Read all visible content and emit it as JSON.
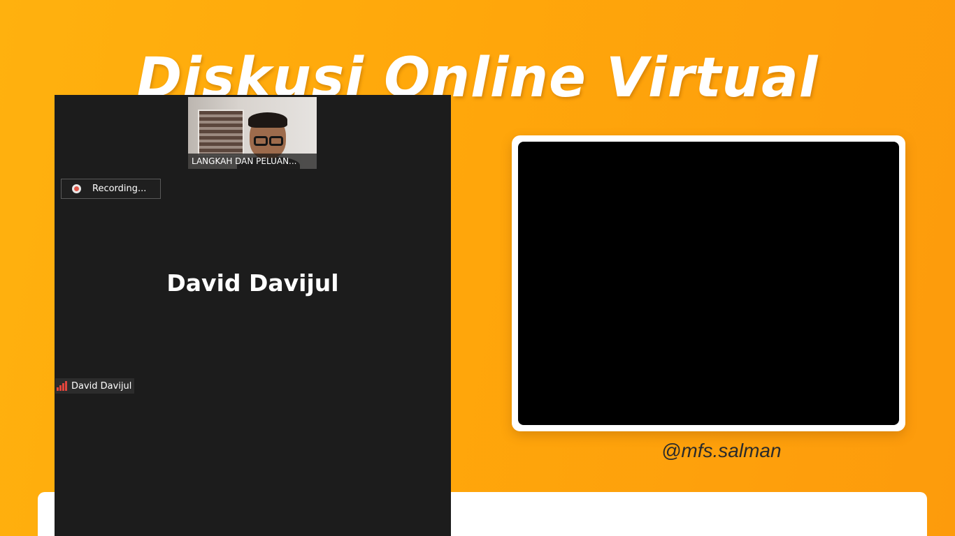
{
  "banner": {
    "title": "Diskusi Online Virtual",
    "handle": "@mfs.salman"
  },
  "meeting": {
    "thumbnail_label": "LANGKAH DAN PELUAN...",
    "recording_label": "Recording...",
    "speaker_name": "David Davijul",
    "name_tag": "David Davijul"
  },
  "colors": {
    "background": "#ffa70b",
    "meeting_bg": "#1c1c1c",
    "recording_accent": "#e0574a",
    "signal": "#e2453c"
  },
  "icons": {
    "recording": "record-icon",
    "signal": "signal-strength-icon"
  }
}
